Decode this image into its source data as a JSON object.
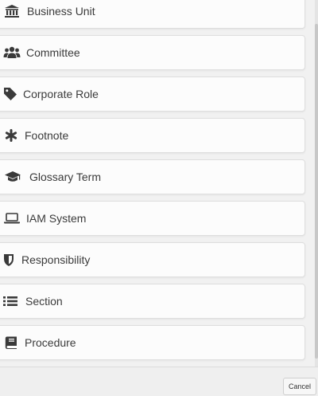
{
  "items": [
    {
      "label": "Business Unit",
      "icon": "bank-icon"
    },
    {
      "label": "Committee",
      "icon": "users-icon"
    },
    {
      "label": "Corporate Role",
      "icon": "tag-icon"
    },
    {
      "label": "Footnote",
      "icon": "asterisk-icon"
    },
    {
      "label": "Glossary Term",
      "icon": "graduation-cap-icon"
    },
    {
      "label": "IAM System",
      "icon": "laptop-icon"
    },
    {
      "label": "Responsibility",
      "icon": "shield-icon"
    },
    {
      "label": "Section",
      "icon": "list-icon"
    },
    {
      "label": "Procedure",
      "icon": "book-icon"
    }
  ],
  "footer": {
    "cancel_label": "Cancel"
  },
  "colors": {
    "icon": "#3a3a3a",
    "text": "#3a3a3a",
    "card_bg": "#fcfcfc",
    "page_bg": "#f1f1f1"
  }
}
